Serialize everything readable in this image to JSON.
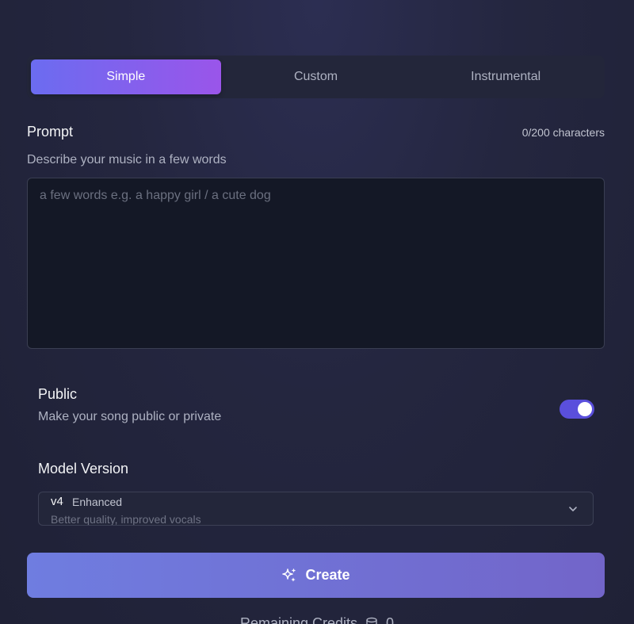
{
  "tabs": [
    {
      "label": "Simple",
      "active": true
    },
    {
      "label": "Custom",
      "active": false
    },
    {
      "label": "Instrumental",
      "active": false
    }
  ],
  "prompt": {
    "label": "Prompt",
    "char_count": "0/200 characters",
    "description": "Describe your music in a few words",
    "placeholder": "a few words e.g. a happy girl / a cute dog",
    "value": ""
  },
  "visibility": {
    "title": "Public",
    "description": "Make your song public or private",
    "enabled": true
  },
  "model": {
    "label": "Model Version",
    "version": "v4",
    "tag": "Enhanced",
    "subtitle": "Better quality, improved vocals"
  },
  "create": {
    "label": "Create"
  },
  "credits": {
    "label": "Remaining Credits",
    "value": "0"
  },
  "colors": {
    "accent_start": "#6b6cf0",
    "accent_end": "#9a55ea",
    "toggle_on": "#5a4fdc",
    "button_start": "#6f7de0",
    "button_end": "#7265c9"
  },
  "icons": {
    "create": "sparkles-icon",
    "model_select": "chevron-down-icon",
    "credits": "database-icon"
  }
}
